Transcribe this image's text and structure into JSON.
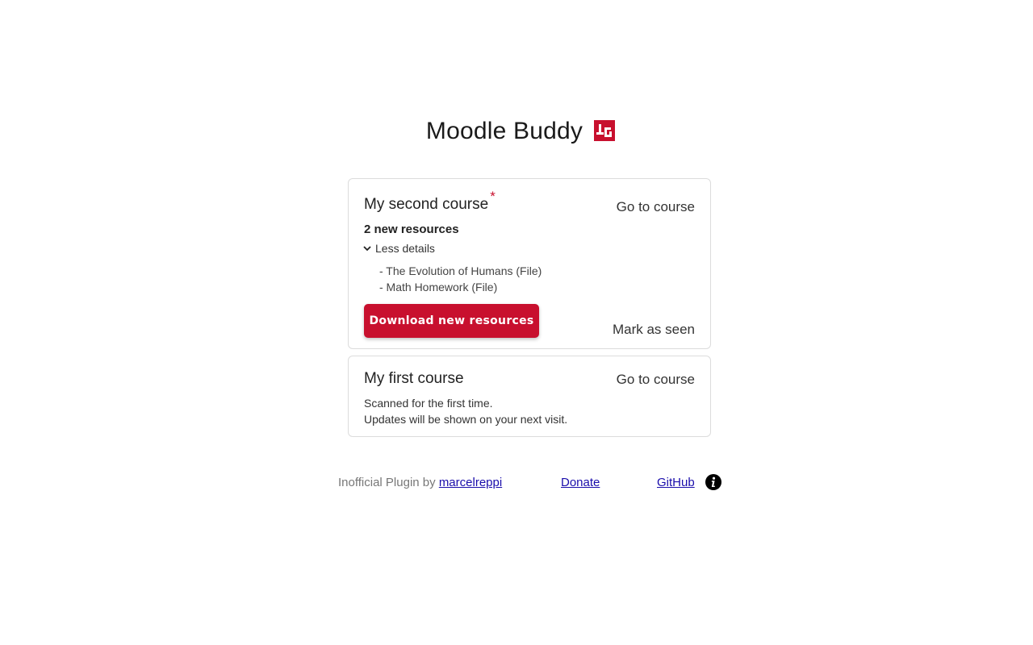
{
  "app": {
    "title": "Moodle Buddy"
  },
  "courses": [
    {
      "name": "My second course",
      "new_marker": "*",
      "go_to_course": "Go to course",
      "new_resources": "2 new resources",
      "details_toggle": "Less details",
      "resources": [
        "- The Evolution of Humans (File)",
        "- Math Homework (File)"
      ],
      "download_label": "Download new resources",
      "mark_seen": "Mark as seen"
    },
    {
      "name": "My first course",
      "go_to_course": "Go to course",
      "scan_line1": "Scanned for the first time.",
      "scan_line2": "Updates will be shown on your next visit."
    }
  ],
  "footer": {
    "credit_prefix": "Inofficial Plugin by ",
    "author": "marcelreppi",
    "donate": "Donate",
    "github": "GitHub"
  },
  "colors": {
    "accent": "#c8102e",
    "link": "#1a0dab"
  },
  "icons": {
    "logo": "moodle-buddy-logo",
    "toggle": "chevron-down-icon",
    "info": "info-icon"
  }
}
